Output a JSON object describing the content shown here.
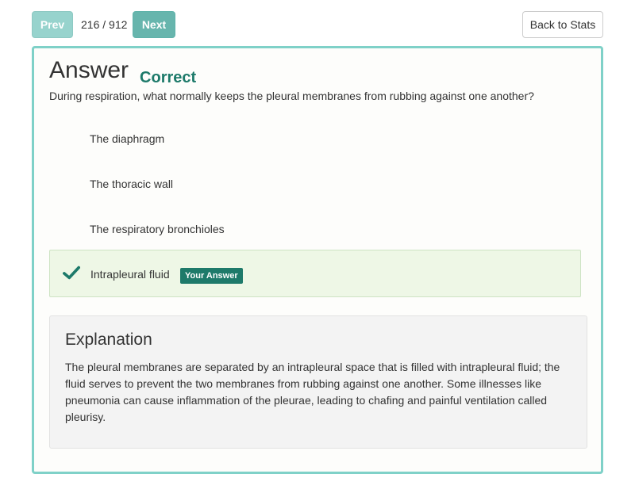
{
  "nav": {
    "prev_label": "Prev",
    "next_label": "Next",
    "counter": "216 / 912",
    "back_label": "Back to Stats"
  },
  "card": {
    "title": "Answer",
    "status": "Correct",
    "question": "During respiration, what normally keeps the pleural membranes from rubbing against one another?",
    "options": [
      {
        "label": "The diaphragm"
      },
      {
        "label": "The thoracic wall"
      },
      {
        "label": "The respiratory bronchioles"
      },
      {
        "label": "Intrapleural fluid",
        "selected": true,
        "correct": true
      }
    ],
    "your_answer_badge": "Your Answer",
    "check_icon": "check-icon"
  },
  "explanation": {
    "title": "Explanation",
    "text": "The pleural membranes are separated by an intrapleural space that is filled with intrapleural fluid; the fluid serves to prevent the two membranes from rubbing against one another. Some illnesses like pneumonia can cause inflammation of the pleurae, leading to chafing and painful ventilation called pleurisy."
  },
  "colors": {
    "accent": "#6cc1b8",
    "card_border": "#7fd1c8",
    "correct_text": "#1d7a6a",
    "answer_bg": "#eef7e6",
    "badge_bg": "#1e7a6a"
  }
}
